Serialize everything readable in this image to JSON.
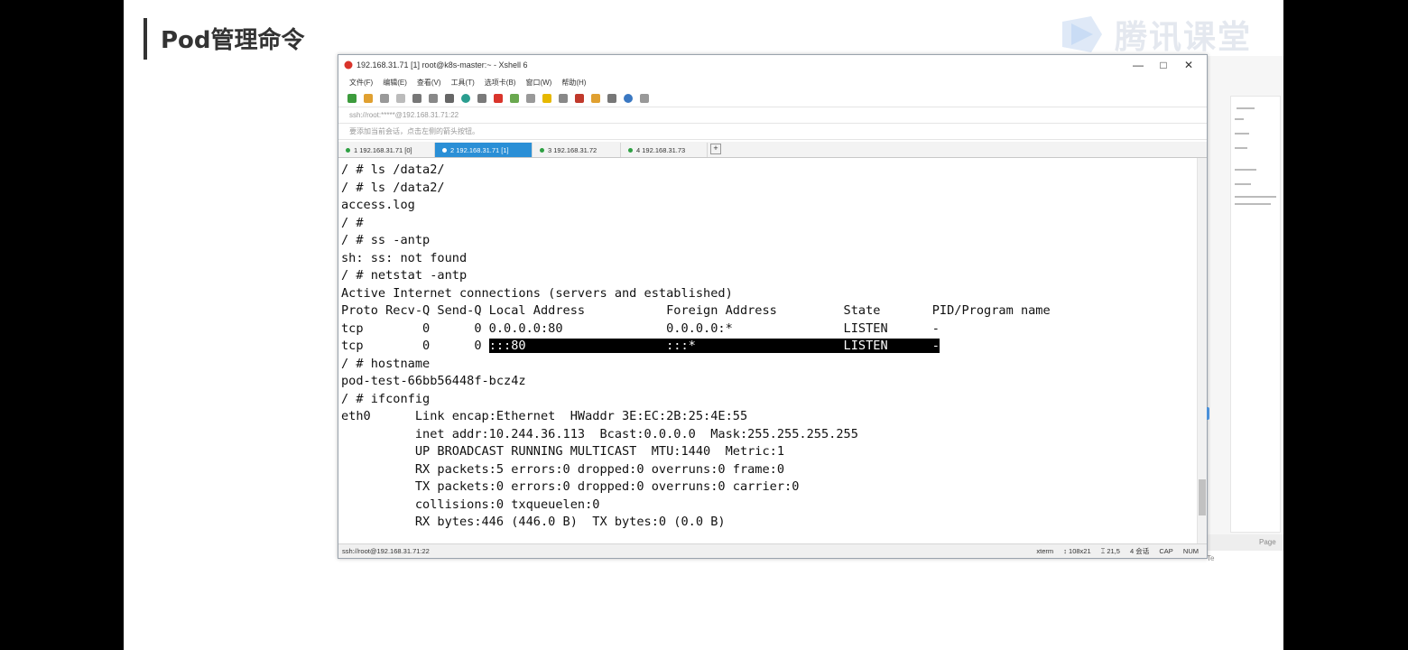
{
  "slide": {
    "title": "Pod管理命令"
  },
  "brand": {
    "name": "腾讯课堂"
  },
  "window": {
    "title": "192.168.31.71 [1]   root@k8s-master:~ - Xshell 6",
    "controls": [
      "—",
      "□",
      "✕"
    ],
    "menu": [
      "文件(F)",
      "编辑(E)",
      "查看(V)",
      "工具(T)",
      "选项卡(B)",
      "窗口(W)",
      "帮助(H)"
    ],
    "address": "ssh://root:*****@192.168.31.71:22",
    "quickbar": "要添加当前会话，点击左侧的箭头按钮。",
    "tabs": [
      {
        "label": "1 192.168.31.71 [0]"
      },
      {
        "label": "2 192.168.31.71 [1]"
      },
      {
        "label": "3 192.168.31.72"
      },
      {
        "label": "4 192.168.31.73"
      }
    ],
    "add_tab": "+"
  },
  "terminal": {
    "lines": [
      "/ # ls /data2/",
      "/ # ls /data2/",
      "access.log",
      "/ #",
      "/ # ss -antp",
      "sh: ss: not found",
      "/ # netstat -antp",
      "Active Internet connections (servers and established)",
      "Proto Recv-Q Send-Q Local Address           Foreign Address         State       PID/Program name",
      "tcp        0      0 0.0.0.0:80              0.0.0.0:*               LISTEN      -",
      "tcp        0      0 ",
      "/ # hostname",
      "pod-test-66bb56448f-bcz4z",
      "/ # ifconfig",
      "eth0      Link encap:Ethernet  HWaddr 3E:EC:2B:25:4E:55",
      "          inet addr:10.244.36.113  Bcast:0.0.0.0  Mask:255.255.255.255",
      "          UP BROADCAST RUNNING MULTICAST  MTU:1440  Metric:1",
      "          RX packets:5 errors:0 dropped:0 overruns:0 frame:0",
      "          TX packets:0 errors:0 dropped:0 overruns:0 carrier:0",
      "          collisions:0 txqueuelen:0",
      "          RX bytes:446 (446.0 B)  TX bytes:0 (0.0 B)"
    ],
    "highlight": ":::80                   :::*                    LISTEN      -"
  },
  "status": {
    "left": "ssh://root@192.168.31.71:22",
    "right": [
      "xterm",
      "↕ 108x21",
      "⌶ 21,5",
      "4 会话",
      "CAP",
      "NUM"
    ]
  },
  "bg_doc": {
    "status": "Page Te"
  }
}
